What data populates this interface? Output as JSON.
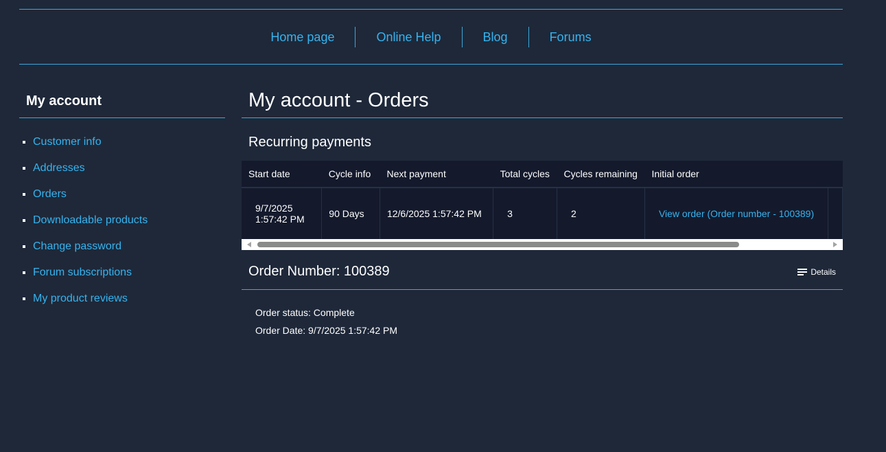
{
  "header": {
    "nav": [
      {
        "label": "Home page"
      },
      {
        "label": "Online Help"
      },
      {
        "label": "Blog"
      },
      {
        "label": "Forums"
      }
    ]
  },
  "sidebar": {
    "title": "My account",
    "items": [
      {
        "label": "Customer info"
      },
      {
        "label": "Addresses"
      },
      {
        "label": "Orders"
      },
      {
        "label": "Downloadable products"
      },
      {
        "label": "Change password"
      },
      {
        "label": "Forum subscriptions"
      },
      {
        "label": "My product reviews"
      }
    ]
  },
  "main": {
    "page_title": "My account - Orders",
    "recurring": {
      "title": "Recurring payments",
      "columns": [
        "Start date",
        "Cycle info",
        "Next payment",
        "Total cycles",
        "Cycles remaining",
        "Initial order"
      ],
      "row": {
        "start_date_line1": "9/7/2025",
        "start_date_line2": "1:57:42 PM",
        "cycle_info": "90 Days",
        "next_payment": "12/6/2025 1:57:42 PM",
        "total_cycles": "3",
        "cycles_remaining": "2",
        "initial_order": "View order (Order number - 100389)"
      }
    },
    "order": {
      "title": "Order Number: 100389",
      "details_label": "Details",
      "status": "Order status: Complete",
      "date": "Order Date: 9/7/2025 1:57:42 PM"
    }
  },
  "colors": {
    "background": "#1e2839",
    "accent": "#36b3ee",
    "table_bg": "#141a2c",
    "divider": "#3aa9dc"
  },
  "icons": {
    "details": "list-lines-icon",
    "bullet": "square-bullet-icon"
  }
}
